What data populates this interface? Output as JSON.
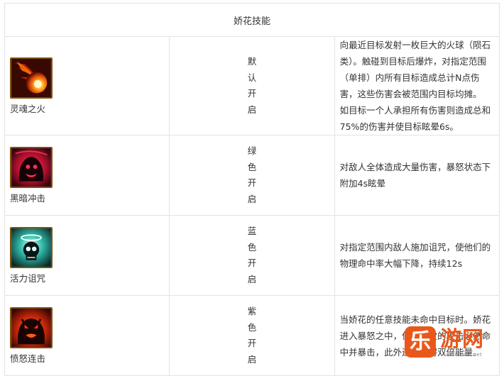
{
  "table": {
    "title": "娇花技能",
    "skills": [
      {
        "name": "灵魂之火",
        "icon": "fireball-icon",
        "unlock": "默认开启",
        "description": "向最近目标发射一枚巨大的火球（陨石类）。触碰到目标后爆炸，对指定范围（单排）内所有目标造成总计N点伤害，这些伤害会被范围内目标均摊。 如目标一个人承担所有伤害则造成总和75%的伤害并使目标眩晕6s。"
      },
      {
        "name": "黑暗冲击",
        "icon": "dark-shadow-icon",
        "unlock": "绿色开启",
        "description": "对敌人全体造成大量伤害，暴怒状态下附加4s眩晕"
      },
      {
        "name": "活力诅咒",
        "icon": "curse-skull-icon",
        "unlock": "蓝色开启",
        "description": "对指定范围内敌人施加诅咒，使他们的物理命中率大幅下降，持续12s"
      },
      {
        "name": "愤怒连击",
        "icon": "fury-demon-icon",
        "unlock": "紫色开启",
        "description": "当娇花的任意技能未命中目标时。娇花进入暴怒之中，使下一次的攻击必然命中并暴击，此外还会获得双倍能量。"
      }
    ]
  },
  "watermark": {
    "logo_char": "乐",
    "text": "游网",
    "url": "www.962.net"
  },
  "colors": {
    "accent": "#e9581a",
    "border": "#e3e3e3",
    "icon_frame": "#7a5410"
  }
}
